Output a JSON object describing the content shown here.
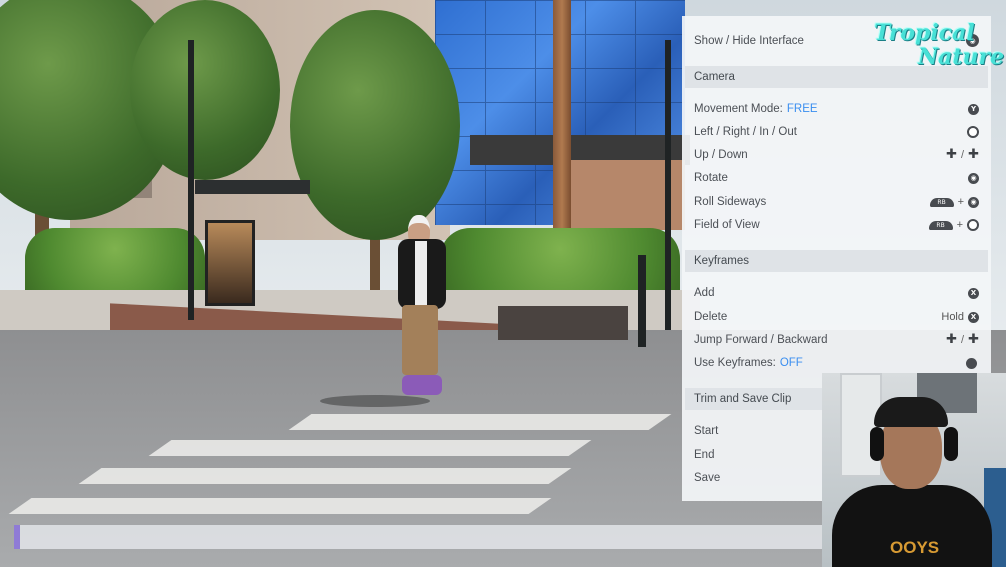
{
  "menu": {
    "show_hide": {
      "label": "Show / Hide Interface",
      "button": "R-stick-click"
    },
    "camera": {
      "header": "Camera",
      "items": [
        {
          "label": "Movement Mode:",
          "value": "FREE",
          "control": "Y"
        },
        {
          "label": "Left / Right / In / Out",
          "control": "L-stick"
        },
        {
          "label": "Up / Down",
          "control": "dpad-up-down"
        },
        {
          "label": "Rotate",
          "control": "R-stick"
        },
        {
          "label": "Roll Sideways",
          "control": "RB + R-stick"
        },
        {
          "label": "Field of View",
          "control": "RB + L-stick"
        }
      ]
    },
    "keyframes": {
      "header": "Keyframes",
      "items": [
        {
          "label": "Add",
          "control": "X"
        },
        {
          "label": "Delete",
          "prefix": "Hold",
          "control": "X"
        },
        {
          "label": "Jump Forward / Backward",
          "control": "dpad-left-right"
        },
        {
          "label": "Use Keyframes:",
          "value": "OFF",
          "control": "view"
        }
      ]
    },
    "trim": {
      "header": "Trim and Save Clip",
      "items": [
        {
          "label": "Start"
        },
        {
          "label": "End"
        },
        {
          "label": "Save"
        }
      ]
    },
    "glyphs": {
      "x": "X",
      "y": "Y",
      "rb": "RB",
      "plus": "+",
      "slash": "/",
      "dpad": "✚",
      "stick": "◉"
    }
  },
  "logo": {
    "line1": "Tropical",
    "line2": "Nature"
  },
  "webcam": {
    "shirt_text": "OOYS"
  },
  "colors": {
    "accent": "#3a8ef0",
    "panel_bg": "#f3f5f7",
    "header_bg": "#dfe3e7",
    "logo": "#48e0d6"
  }
}
